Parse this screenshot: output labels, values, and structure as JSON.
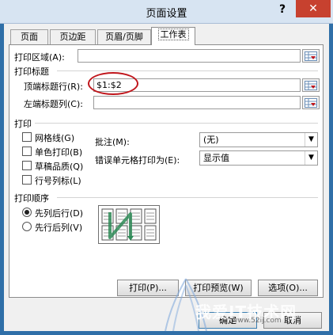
{
  "window": {
    "title": "页面设置",
    "help": "?",
    "close": "✕"
  },
  "tabs": [
    {
      "label": "页面"
    },
    {
      "label": "页边距"
    },
    {
      "label": "页眉/页脚"
    },
    {
      "label": "工作表"
    }
  ],
  "print_area": {
    "label": "打印区域(A):",
    "value": ""
  },
  "print_titles": {
    "group_label": "打印标题",
    "top_rows_label": "顶端标题行(R):",
    "top_rows_value": "$1:$2",
    "left_cols_label": "左端标题列(C):",
    "left_cols_value": ""
  },
  "print": {
    "group_label": "打印",
    "checkboxes": [
      {
        "label": "网格线(G)"
      },
      {
        "label": "单色打印(B)"
      },
      {
        "label": "草稿品质(Q)"
      },
      {
        "label": "行号列标(L)"
      }
    ],
    "comments_label": "批注(M):",
    "comments_value": "(无)",
    "errors_label": "错误单元格打印为(E):",
    "errors_value": "显示值"
  },
  "page_order": {
    "group_label": "打印顺序",
    "options": [
      {
        "label": "先列后行(D)",
        "selected": true
      },
      {
        "label": "先行后列(V)",
        "selected": false
      }
    ]
  },
  "buttons": {
    "print": "打印(P)...",
    "preview": "打印预览(W)",
    "options": "选项(O)...",
    "ok": "确定",
    "cancel": "取消"
  },
  "watermark": {
    "text": "我爱IT技术网",
    "sub": "www.52ij.com"
  },
  "colors": {
    "annotation": "#c0161c",
    "window_frame": "#2f6fa8",
    "titlebar": "#d7e4f2",
    "close": "#c7412f"
  },
  "icons": [
    "range-picker-icon",
    "dropdown-arrow-icon",
    "page-order-preview-icon"
  ]
}
